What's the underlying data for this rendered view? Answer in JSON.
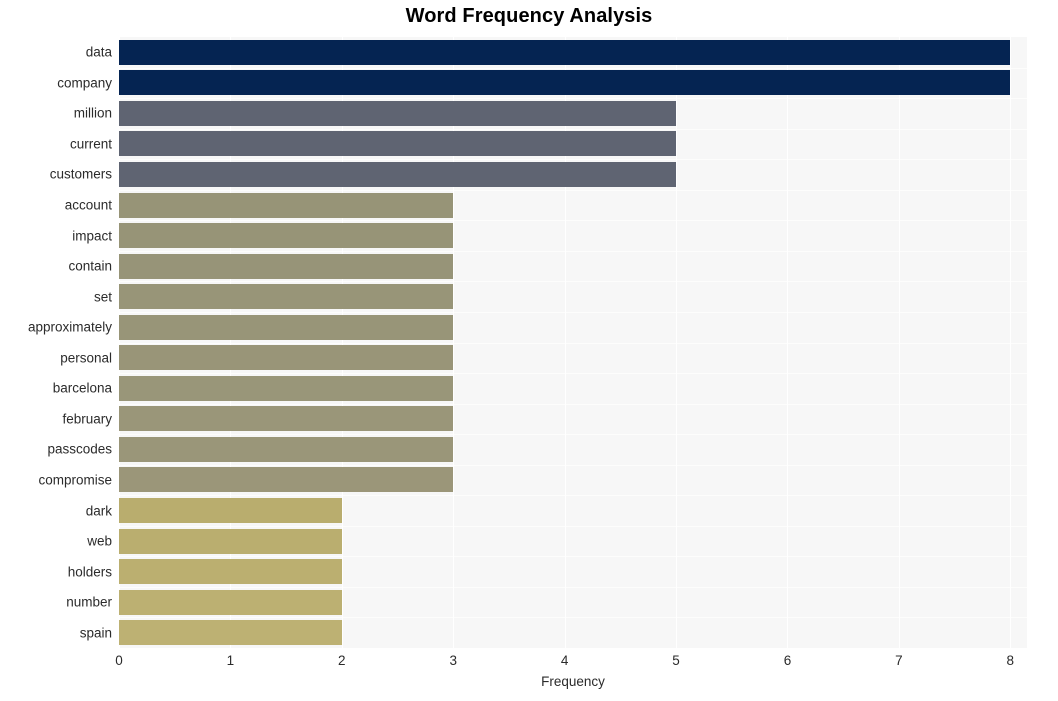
{
  "chart_data": {
    "type": "bar",
    "orientation": "horizontal",
    "title": "Word Frequency Analysis",
    "xlabel": "Frequency",
    "ylabel": "",
    "xlim": [
      0,
      8.15
    ],
    "xticks": [
      0,
      1,
      2,
      3,
      4,
      5,
      6,
      7,
      8
    ],
    "xtick_labels": [
      "0",
      "1",
      "2",
      "3",
      "4",
      "5",
      "6",
      "7",
      "8"
    ],
    "grid": true,
    "legend": null,
    "categories": [
      "data",
      "company",
      "million",
      "current",
      "customers",
      "account",
      "impact",
      "contain",
      "set",
      "approximately",
      "personal",
      "barcelona",
      "february",
      "passcodes",
      "compromise",
      "dark",
      "web",
      "holders",
      "number",
      "spain"
    ],
    "values": [
      8,
      8,
      5,
      5,
      5,
      3,
      3,
      3,
      3,
      3,
      3,
      3,
      3,
      3,
      3,
      2,
      2,
      2,
      2,
      2
    ],
    "bar_colors": [
      "#052452",
      "#052452",
      "#5f6472",
      "#5f6472",
      "#5f6472",
      "#979477",
      "#979477",
      "#979478",
      "#989578",
      "#989578",
      "#999578",
      "#999679",
      "#9a9679",
      "#9a9679",
      "#9b9679",
      "#b9ad6e",
      "#baae6f",
      "#bbaf70",
      "#bcb072",
      "#bdb173"
    ],
    "plot_background": "#f7f7f7",
    "grid_color": "#ffffff",
    "figure_background": "#ffffff"
  }
}
